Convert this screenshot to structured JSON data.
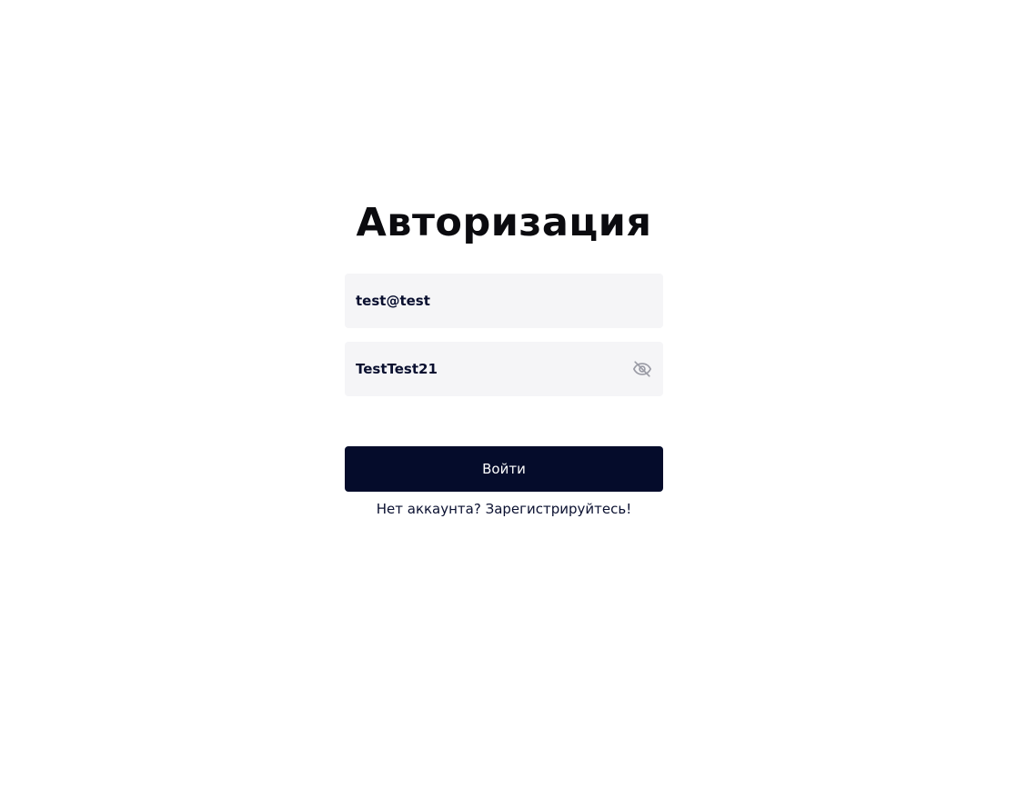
{
  "auth": {
    "title": "Авторизация",
    "email_value": "test@test",
    "password_value": "TestTest21",
    "password_toggle_icon": "eye-off-icon",
    "submit_label": "Войти",
    "register_link": "Нет аккаунта? Зарегистрируйтесь!"
  },
  "colors": {
    "primary_button": "#050c2b",
    "field_background": "#f5f5f7",
    "icon_gray": "#9a9ba5"
  }
}
